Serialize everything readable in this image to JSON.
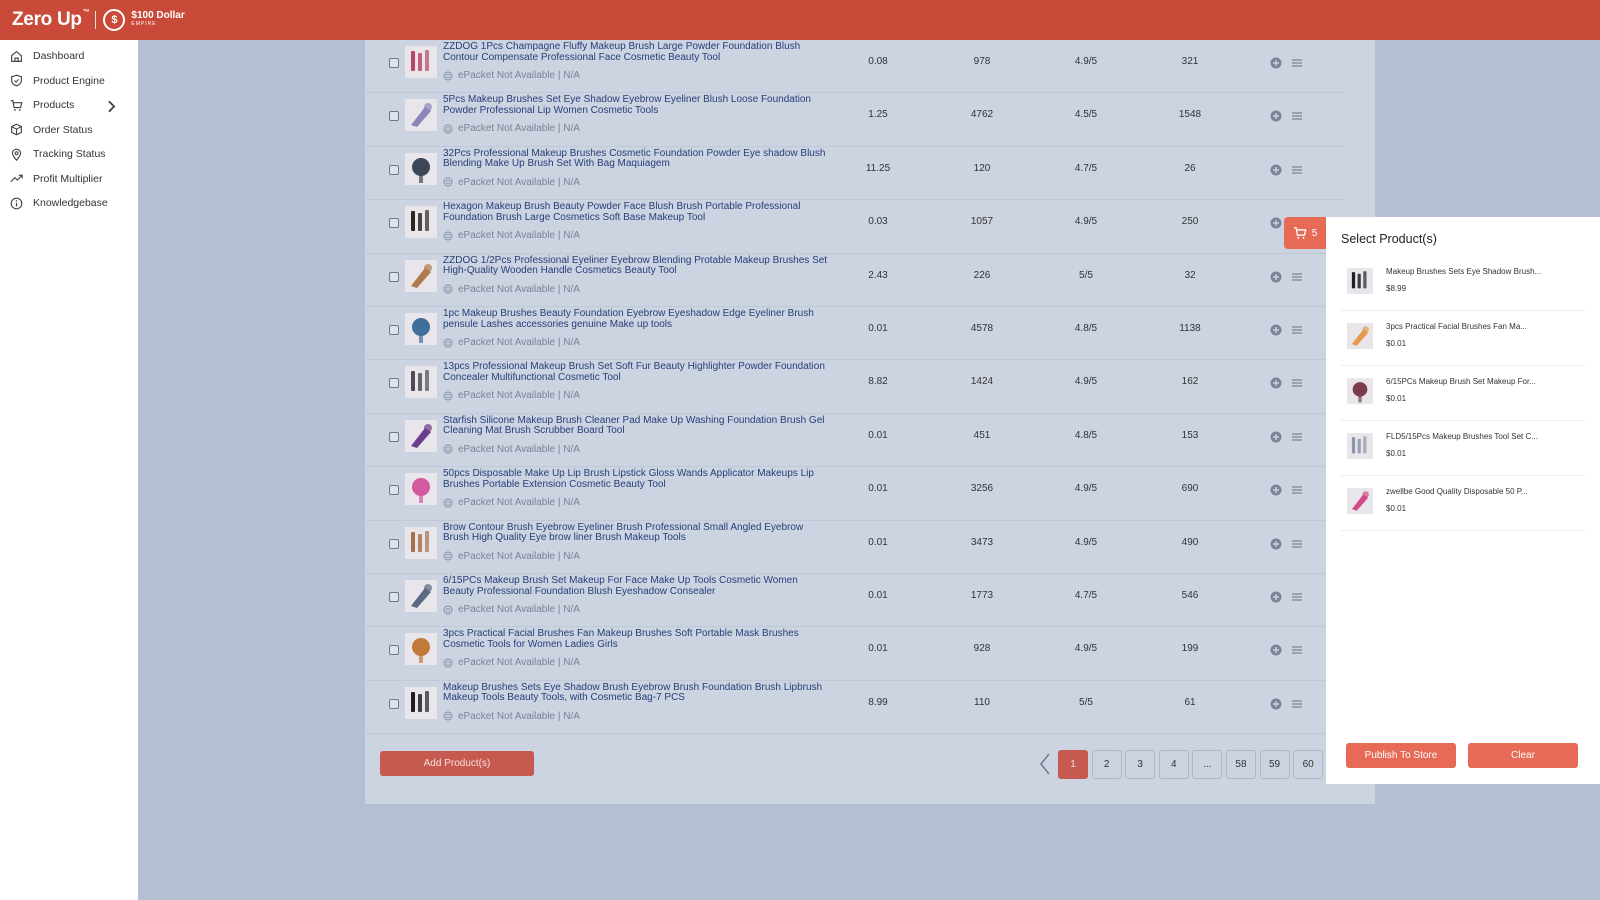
{
  "brand": {
    "name": "Zero Up",
    "tm": "™",
    "badge_symbol": "$",
    "partner_line1": "$100 Dollar",
    "partner_line2": "EMPIRE",
    "color": "#c94a38"
  },
  "sidebar": {
    "items": [
      {
        "label": "Dashboard",
        "icon": "home-icon"
      },
      {
        "label": "Product Engine",
        "icon": "shield-icon"
      },
      {
        "label": "Products",
        "icon": "cart-icon",
        "has_chevron": true
      },
      {
        "label": "Order Status",
        "icon": "box-icon"
      },
      {
        "label": "Tracking Status",
        "icon": "location-pin-icon"
      },
      {
        "label": "Profit Multiplier",
        "icon": "trending-up-icon"
      },
      {
        "label": "Knowledgebase",
        "icon": "info-icon"
      }
    ]
  },
  "products": [
    {
      "title": "ZZDOG 1Pcs Champagne Fluffy Makeup Brush Large Powder Foundation Blush Contour Compensate Professional Face Cosmetic Beauty Tool",
      "shipping": "ePacket Not Available | N/A",
      "price": "0.08",
      "orders": "978",
      "rating": "4.9/5",
      "reviews": "321",
      "thumb_color": "#b9466a"
    },
    {
      "title": "5Pcs Makeup Brushes Set Eye Shadow Eyebrow Eyeliner Blush Loose Foundation Powder Professional Lip Women Cosmetic Tools",
      "shipping": "ePacket Not Available | N/A",
      "price": "1.25",
      "orders": "4762",
      "rating": "4.5/5",
      "reviews": "1548",
      "thumb_color": "#8a86b8"
    },
    {
      "title": "32Pcs Professional Makeup Brushes Cosmetic Foundation Powder Eye shadow Blush Blending Make Up Brush Set With Bag Maquiagem",
      "shipping": "ePacket Not Available | N/A",
      "price": "11.25",
      "orders": "120",
      "rating": "4.7/5",
      "reviews": "26",
      "thumb_color": "#3d4656"
    },
    {
      "title": "Hexagon Makeup Brush Beauty Powder Face Blush Brush Portable Professional Foundation Brush Large Cosmetics Soft Base Makeup Tool",
      "shipping": "ePacket Not Available | N/A",
      "price": "0.03",
      "orders": "1057",
      "rating": "4.9/5",
      "reviews": "250",
      "thumb_color": "#2c2620"
    },
    {
      "title": "ZZDOG 1/2Pcs Professional Eyeliner Eyebrow Blending Protable Makeup Brushes Set High-Quality Wooden Handle Cosmetics Beauty Tool",
      "shipping": "ePacket Not Available | N/A",
      "price": "2.43",
      "orders": "226",
      "rating": "5/5",
      "reviews": "32",
      "thumb_color": "#b07a50"
    },
    {
      "title": "1pc Makeup Brushes Beauty Foundation Eyebrow Eyeshadow Edge Eyeliner Brush pensule Lashes accessories genuine Make up tools",
      "shipping": "ePacket Not Available | N/A",
      "price": "0.01",
      "orders": "4578",
      "rating": "4.8/5",
      "reviews": "1138",
      "thumb_color": "#3f6f9a"
    },
    {
      "title": "13pcs Professional Makeup Brush Set Soft Fur Beauty Highlighter Powder Foundation Concealer Multifunctional Cosmetic Tool",
      "shipping": "ePacket Not Available | N/A",
      "price": "8.82",
      "orders": "1424",
      "rating": "4.9/5",
      "reviews": "162",
      "thumb_color": "#4e4b58"
    },
    {
      "title": "Starfish Silicone Makeup Brush Cleaner Pad Make Up Washing Foundation Brush Gel Cleaning Mat Brush Scrubber Board Tool",
      "shipping": "ePacket Not Available | N/A",
      "price": "0.01",
      "orders": "451",
      "rating": "4.8/5",
      "reviews": "153",
      "thumb_color": "#6b3d8c"
    },
    {
      "title": "50pcs Disposable Make Up Lip Brush Lipstick Gloss Wands Applicator Makeups Lip Brushes Portable Extension Cosmetic Beauty Tool",
      "shipping": "ePacket Not Available | N/A",
      "price": "0.01",
      "orders": "3256",
      "rating": "4.9/5",
      "reviews": "690",
      "thumb_color": "#d45aa0"
    },
    {
      "title": "Brow Contour Brush Eyebrow Eyeliner Brush Professional Small Angled Eyebrow Brush High Quality Eye brow liner Brush Makeup Tools",
      "shipping": "ePacket Not Available | N/A",
      "price": "0.01",
      "orders": "3473",
      "rating": "4.9/5",
      "reviews": "490",
      "thumb_color": "#a8704a"
    },
    {
      "title": "6/15PCs Makeup Brush Set Makeup For Face Make Up Tools Cosmetic Women Beauty Professional Foundation Blush Eyeshadow Consealer",
      "shipping": "ePacket Not Available | N/A",
      "price": "0.01",
      "orders": "1773",
      "rating": "4.7/5",
      "reviews": "546",
      "thumb_color": "#5a6a82"
    },
    {
      "title": "3pcs Practical Facial Brushes Fan Makeup Brushes Soft Portable Mask Brushes Cosmetic Tools for Women Ladies Girls",
      "shipping": "ePacket Not Available | N/A",
      "price": "0.01",
      "orders": "928",
      "rating": "4.9/5",
      "reviews": "199",
      "thumb_color": "#c27a3a"
    },
    {
      "title": "Makeup Brushes Sets Eye Shadow Brush Eyebrow Brush Foundation Brush Lipbrush Makeup Tools Beauty Tools, with Cosmetic Bag-7 PCS",
      "shipping": "ePacket Not Available | N/A",
      "price": "8.99",
      "orders": "110",
      "rating": "5/5",
      "reviews": "61",
      "thumb_color": "#1e1e24"
    }
  ],
  "add_button": "Add Product(s)",
  "pagination": {
    "pages": [
      "1",
      "2",
      "3",
      "4",
      "...",
      "58",
      "59",
      "60"
    ],
    "active": "1"
  },
  "cart": {
    "count": "5"
  },
  "drawer": {
    "title": "Select Product(s)",
    "items": [
      {
        "name": "Makeup Brushes Sets Eye Shadow Brush...",
        "price": "$8.99",
        "thumb_color": "#1e1e24"
      },
      {
        "name": "3pcs Practical Facial Brushes Fan Ma...",
        "price": "$0.01",
        "thumb_color": "#e39a4a"
      },
      {
        "name": "6/15PCs Makeup Brush Set Makeup For...",
        "price": "$0.01",
        "thumb_color": "#7d3c4a"
      },
      {
        "name": "FLD5/15Pcs Makeup Brushes Tool Set C...",
        "price": "$0.01",
        "thumb_color": "#8a93a8"
      },
      {
        "name": "zwellbe Good Quality Disposable 50 P...",
        "price": "$0.01",
        "thumb_color": "#d24a8a"
      }
    ],
    "publish_label": "Publish To Store",
    "clear_label": "Clear"
  },
  "colors": {
    "accent": "#e66a55",
    "overlay": "#b5bfd3",
    "link": "#27407a"
  }
}
